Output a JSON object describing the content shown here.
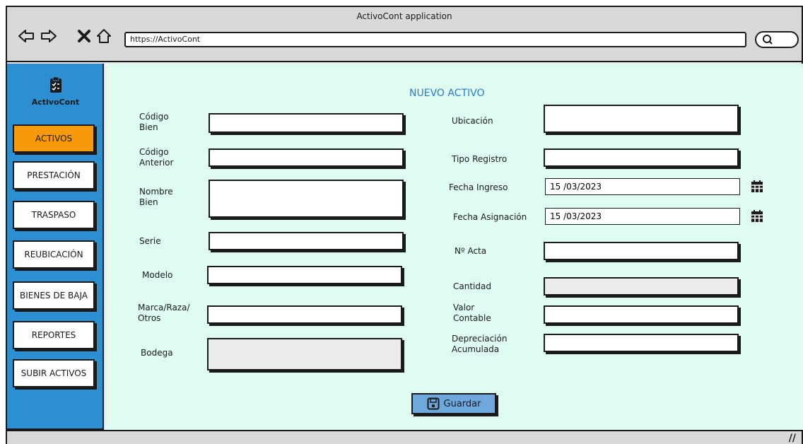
{
  "window": {
    "title": "ActivoCont application"
  },
  "browser": {
    "url": "https://ActivoCont"
  },
  "sidebar": {
    "brand": "ActivoCont",
    "items": [
      {
        "label": "ACTIVOS"
      },
      {
        "label": "PRESTACIÓN"
      },
      {
        "label": "TRASPASO"
      },
      {
        "label": "REUBICACIÓN"
      },
      {
        "label": "BIENES DE BAJA"
      },
      {
        "label": "REPORTES"
      },
      {
        "label": "SUBIR ACTIVOS"
      }
    ]
  },
  "form": {
    "title": "NUEVO ACTIVO",
    "left": {
      "codigo_bien": "Código\nBien",
      "codigo_anterior": "Código\nAnterior",
      "nombre_bien": "Nombre\nBien",
      "serie": "Serie",
      "modelo": "Modelo",
      "marca": "Marca/Raza/\nOtros",
      "bodega": "Bodega"
    },
    "right": {
      "ubicacion": "Ubicación",
      "tipo_registro": "Tipo Registro",
      "fecha_ingreso": "Fecha Ingreso",
      "fecha_ingreso_value": "15 /03/2023",
      "fecha_asignacion": "Fecha Asignación",
      "fecha_asignacion_value": "15 /03/2023",
      "nro_acta": "Nº Acta",
      "cantidad": "Cantidad",
      "valor_contable": "Valor\nContable",
      "depreciacion": "Depreciación\nAcumulada"
    },
    "save_label": "Guardar"
  },
  "colors": {
    "sidebar": "#2b8fd1",
    "active_item": "#f79a09",
    "main_bg": "#dffcf0",
    "title": "#2b7bd1",
    "save_button": "#6fa8dc"
  },
  "icons": [
    "back-arrow-icon",
    "forward-arrow-icon",
    "close-icon",
    "home-icon",
    "search-icon",
    "clipboard-icon",
    "calendar-icon",
    "save-icon",
    "resize-grip-icon"
  ]
}
